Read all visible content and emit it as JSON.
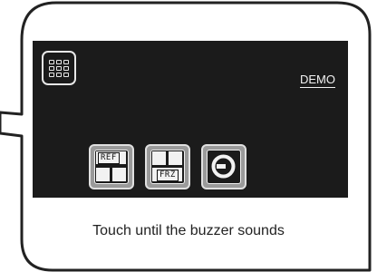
{
  "screen": {
    "demo_label": "DEMO"
  },
  "toolbar": {
    "ref_label": "REF",
    "frz_label": "FRZ"
  },
  "caption": "Touch until the buzzer sounds",
  "icons": {
    "menu": "grid-menu-icon",
    "ref": "ref-split-icon",
    "frz": "freeze-split-icon",
    "power": "power-icon"
  },
  "colors": {
    "screen_bg": "#1b1b1b",
    "button_bg": "#9a9a9a",
    "callout_border": "#222222"
  }
}
